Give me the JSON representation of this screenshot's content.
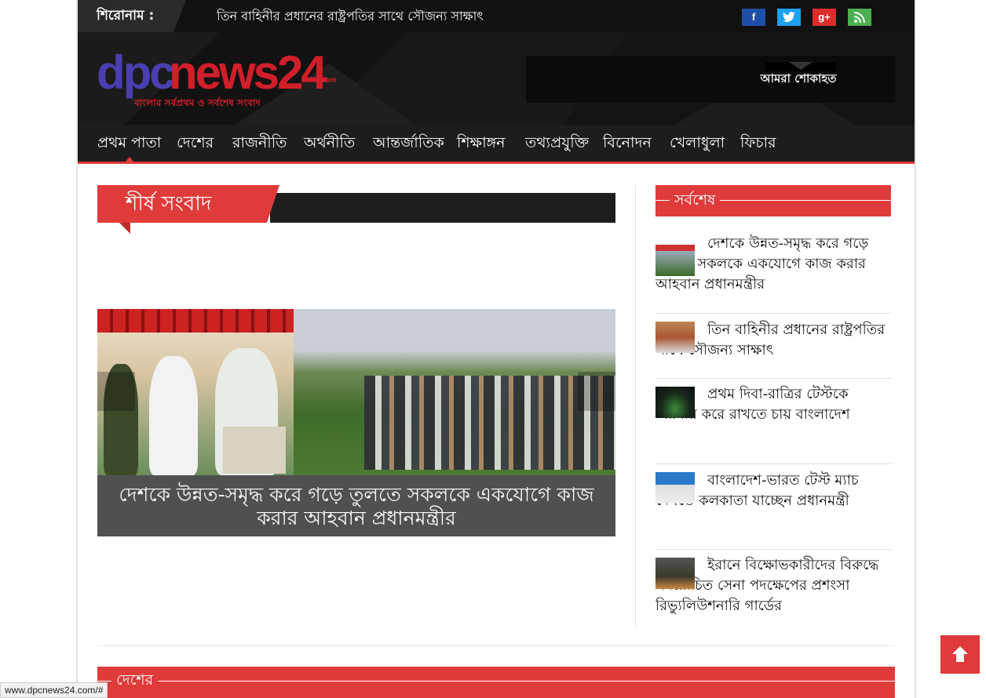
{
  "ticker": {
    "label": "শিরোনাম :",
    "headline": "তিন বাহিনীর প্রধানের রাষ্ট্রপতির সাথে সৌজন্য সাক্ষাৎ"
  },
  "social": [
    {
      "name": "facebook-icon",
      "glyph": "f",
      "color": "#3b5998"
    },
    {
      "name": "twitter-icon",
      "glyph": "🐦",
      "color": "#1da1f2"
    },
    {
      "name": "google-plus-icon",
      "glyph": "g+",
      "color": "#dd2c2c"
    },
    {
      "name": "rss-icon",
      "glyph": "ऽ৷",
      "color": "#4caf50"
    }
  ],
  "logo": {
    "dpc": "dpc",
    "news": "news24",
    "com": ".com",
    "tagline": "বাংলার সর্বপ্রথম ও সর্বশেষ সংবাদ"
  },
  "ad": {
    "text": "আমরা শোকাহত"
  },
  "nav": [
    {
      "label": "প্রথম পাতা",
      "active": true
    },
    {
      "label": "দেশের"
    },
    {
      "label": "রাজনীতি"
    },
    {
      "label": "অর্থনীতি"
    },
    {
      "label": "আন্তর্জাতিক"
    },
    {
      "label": "শিক্ষাঙ্গন"
    },
    {
      "label": "তথ্যপ্রযুক্তি"
    },
    {
      "label": "বিনোদন"
    },
    {
      "label": "খেলাধুলা"
    },
    {
      "label": "ফিচার"
    }
  ],
  "main": {
    "section_title": "শীর্ষ সংবাদ",
    "featured_caption": "দেশকে উন্নত-সমৃদ্ধ করে গড়ে তুলতে সকলকে একযোগে কাজ করার আহবান প্রধানমন্ত্রীর"
  },
  "sidebar": {
    "title": "সর্বশেষ",
    "items": [
      {
        "text": "দেশকে উন্নত-সমৃদ্ধ করে গড়ে তুলতে সকলকে একযোগে কাজ করার আহবান প্রধানমন্ত্রীর"
      },
      {
        "text": "তিন বাহিনীর প্রধানের রাষ্ট্রপতির সাথে সৌজন্য সাক্ষাৎ"
      },
      {
        "text": "প্রথম দিবা-রাত্রির টেস্টকে স্মরণীয় করে রাখতে চায় বাংলাদেশ"
      },
      {
        "text": "বাংলাদেশ-ভারত টেস্ট ম্যাচ দেখতে কলকাতা যাচ্ছেন প্রধানমন্ত্রী"
      },
      {
        "text": "ইরানে বিক্ষোভকারীদের বিরুদ্ধে সময়োচিত সেনা পদক্ষেপের প্রশংসা রিভ্যুলিউশনারি গার্ডের"
      }
    ]
  },
  "bottom_section": {
    "title": "দেশের"
  },
  "status_bar": {
    "url": "www.dpcnews24.com/#"
  },
  "colors": {
    "accent": "#e03b3b",
    "dark": "#1d1d1d"
  }
}
